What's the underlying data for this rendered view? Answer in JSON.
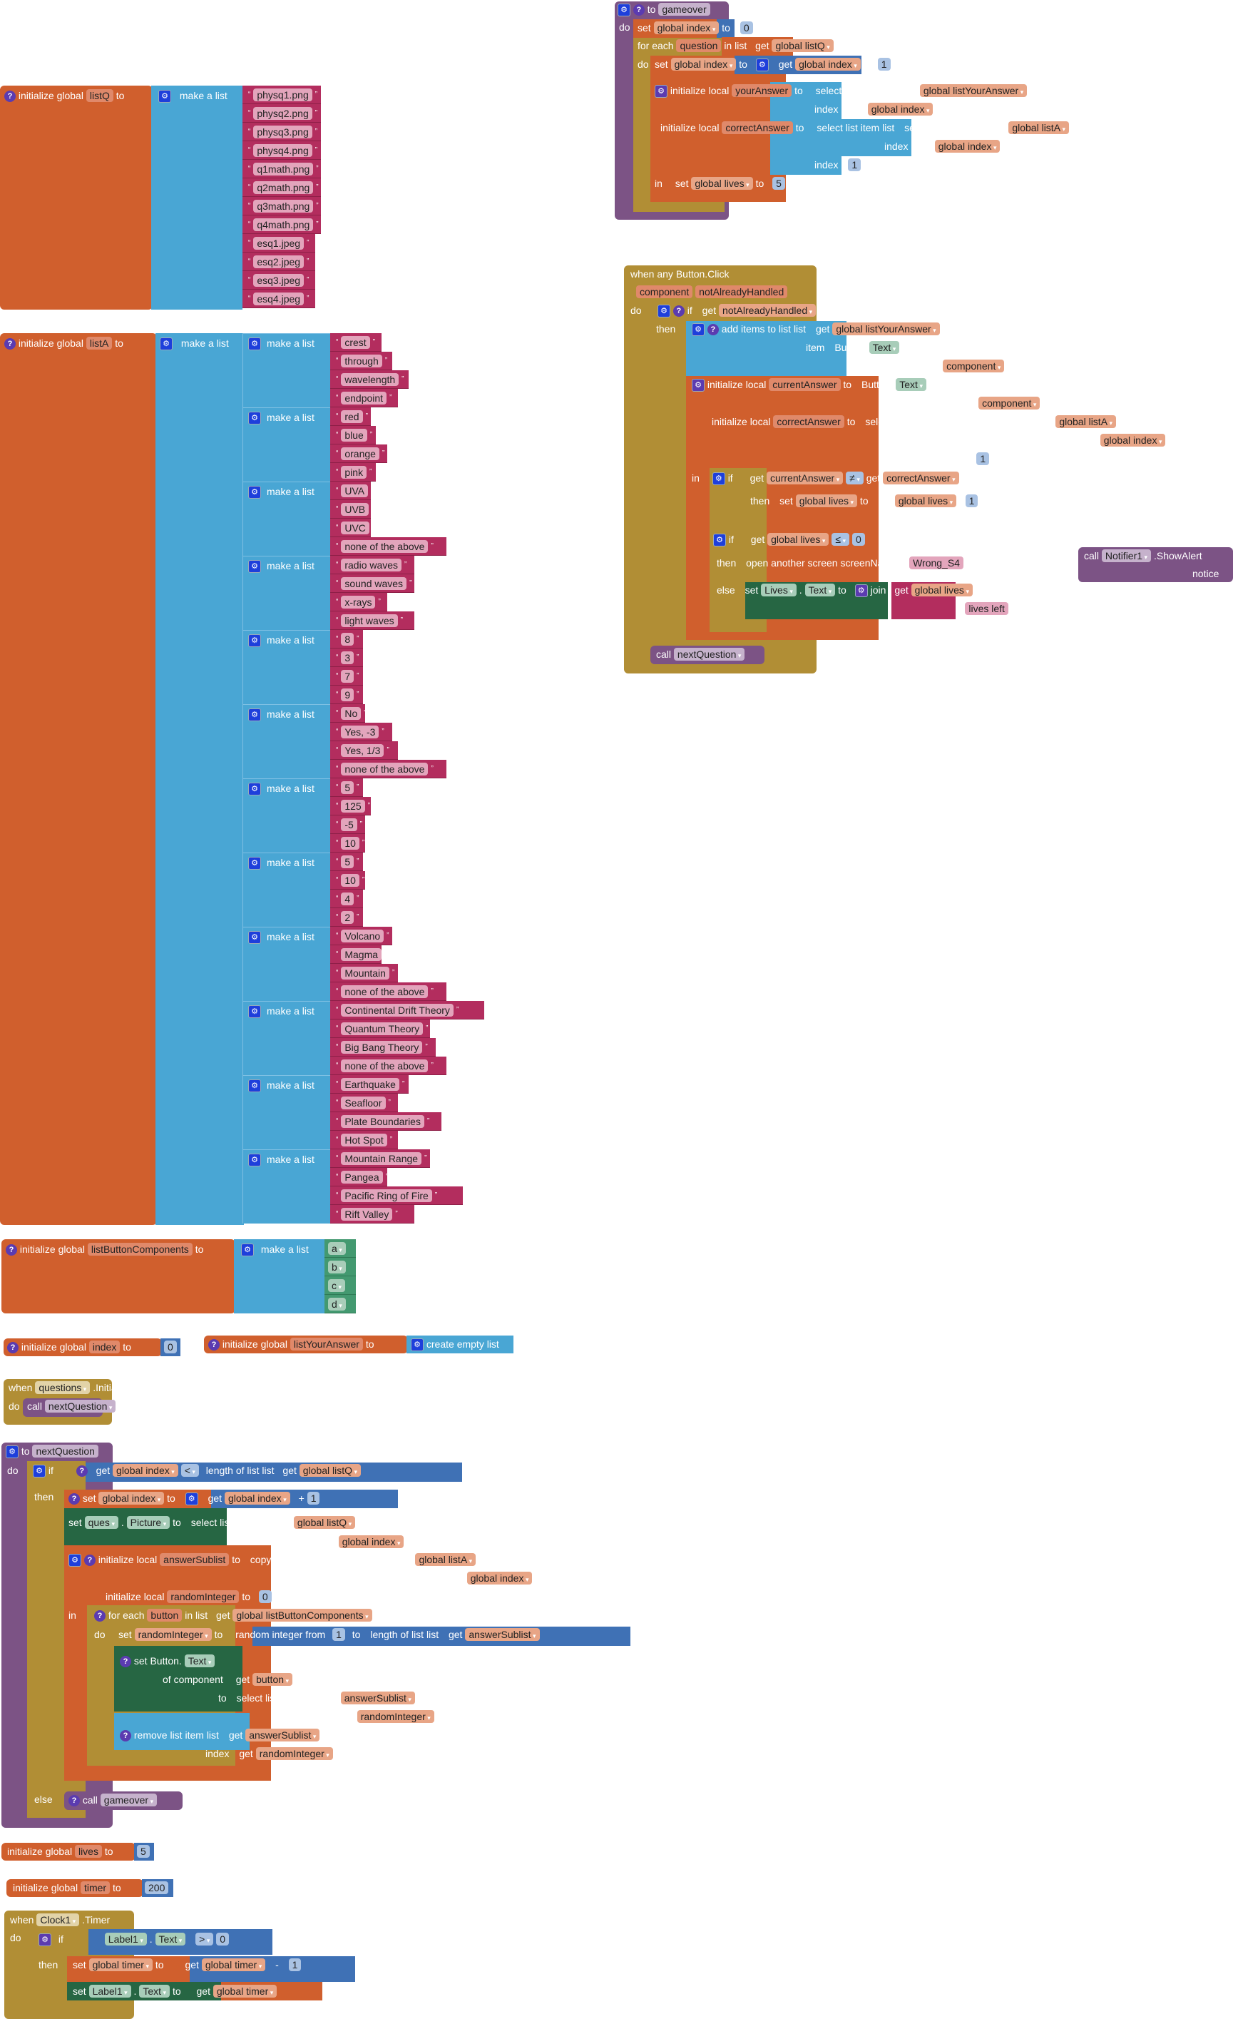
{
  "listQ": {
    "init_label": "initialize global",
    "var_name": "listQ",
    "to_label": "to",
    "make_list_label": "make a list",
    "items": [
      "physq1.png",
      "physq2.png",
      "physq3.png",
      "physq4.png",
      "q1math.png",
      "q2math.png",
      "q3math.png",
      "q4math.png",
      "esq1.jpeg",
      "esq2.jpeg",
      "esq3.jpeg",
      "esq4.jpeg"
    ]
  },
  "listA": {
    "init_label": "initialize global",
    "var_name": "listA",
    "to_label": "to",
    "make_list_label": "make a list",
    "groups": [
      [
        "crest",
        "through",
        "wavelength",
        "endpoint"
      ],
      [
        "red",
        "blue",
        "orange",
        "pink"
      ],
      [
        "UVA",
        "UVB",
        "UVC",
        "none of the above"
      ],
      [
        "radio waves",
        "sound waves",
        "x-rays",
        "light waves"
      ],
      [
        "8",
        "3",
        "7",
        "9"
      ],
      [
        "No",
        "Yes, -3",
        "Yes, 1/3",
        "none of the above"
      ],
      [
        "5",
        "125",
        "-5",
        "10"
      ],
      [
        "5",
        "10",
        "4",
        "2"
      ],
      [
        "Volcano",
        "Magma",
        "Mountain",
        "none of the above"
      ],
      [
        "Continental Drift Theory",
        "Quantum Theory",
        "Big Bang Theory",
        "none of the above"
      ],
      [
        "Earthquake",
        "Seafloor",
        "Plate Boundaries",
        "Hot Spot"
      ],
      [
        "Mountain Range",
        "Pangea",
        "Pacific Ring of Fire",
        "Rift Valley"
      ]
    ]
  },
  "listButtonComponents": {
    "init_label": "initialize global",
    "var_name": "listButtonComponents",
    "to_label": "to",
    "make_list_label": "make a list",
    "items": [
      "a",
      "b",
      "c",
      "d"
    ]
  },
  "index_init": {
    "init_label": "initialize global",
    "var_name": "index",
    "to_label": "to",
    "value": "0"
  },
  "listYourAnswer_init": {
    "init_label": "initialize global",
    "var_name": "listYourAnswer",
    "to_label": "to",
    "value_label": "create empty list"
  },
  "questions_init": {
    "when": "when",
    "component": "questions",
    "event": ".Initialize",
    "do": "do",
    "call": "call",
    "proc": "nextQuestion"
  },
  "gameover": {
    "to": "to",
    "name": "gameover",
    "do": "do",
    "set": "set",
    "global_index": "global index",
    "zero": "0",
    "for_each": "for each",
    "question": "question",
    "in_list": "in list",
    "get": "get",
    "global_listQ": "global listQ",
    "do2": "do",
    "plus": "+",
    "one": "1",
    "init_local": "initialize local",
    "yourAnswer": "yourAnswer",
    "select_list_item": "select list item",
    "list": "list",
    "index": "index",
    "global_listYourAnswer": "global listYourAnswer",
    "correctAnswer": "correctAnswer",
    "global_listA": "global listA",
    "in": "in",
    "global_lives": "global lives",
    "five": "5"
  },
  "button_click": {
    "title": "when any Button.Click",
    "param_component": "component",
    "param_notAlreadyHandled": "notAlreadyHandled",
    "do": "do",
    "if": "if",
    "get": "get",
    "then": "then",
    "add_items": "add items to list",
    "list": "list",
    "item": "item",
    "global_listYourAnswer": "global listYourAnswer",
    "button": "Button.",
    "text": "Text",
    "of_component": "of component",
    "component": "component",
    "init_local": "initialize local",
    "currentAnswer": "currentAnswer",
    "to": "to",
    "correctAnswer": "correctAnswer",
    "select_list_item": "select list item",
    "global_listA": "global listA",
    "index": "index",
    "global_index": "global index",
    "one": "1",
    "in": "in",
    "neq": "≠",
    "set": "set",
    "global_lives": "global lives",
    "minus": "-",
    "lte": "≤",
    "zero": "0",
    "open_screen": "open another screen",
    "screenName": "screenName",
    "screen_value": "Wrong_S4",
    "else": "else",
    "lives_comp": "Lives",
    "join": "join",
    "lives_left": "lives left",
    "call": "call",
    "nextQuestion": "nextQuestion"
  },
  "notifier": {
    "call": "call",
    "component": "Notifier1",
    "method": ".ShowAlert",
    "notice": "notice"
  },
  "nextQuestion": {
    "to": "to",
    "name": "nextQuestion",
    "do": "do",
    "if": "if",
    "get": "get",
    "global_index": "global index",
    "lt": "<",
    "length_of_list": "length of list",
    "list": "list",
    "global_listQ": "global listQ",
    "then": "then",
    "set": "set",
    "plus": "+",
    "one": "1",
    "ques": "ques",
    "picture": "Picture",
    "select_list_item": "select list item",
    "index": "index",
    "init_local": "initialize local",
    "answerSublist": "answerSublist",
    "copy_list": "copy list",
    "global_listA": "global listA",
    "randomInteger": "randomInteger",
    "zero": "0",
    "in": "in",
    "for_each": "for each",
    "button": "button",
    "in_list": "in list",
    "global_listButtonComponents": "global listButtonComponents",
    "random_from": "random integer from",
    "to_label": "to",
    "set_button": "set Button.",
    "text": "Text",
    "of_component": "of component",
    "remove_item": "remove list item",
    "else": "else",
    "call": "call",
    "gameover": "gameover"
  },
  "lives_init": {
    "init_label": "initialize global",
    "var_name": "lives",
    "to_label": "to",
    "value": "5"
  },
  "timer_init": {
    "init_label": "initialize global",
    "var_name": "timer",
    "to_label": "to",
    "value": "200"
  },
  "clock": {
    "when": "when",
    "component": "Clock1",
    "event": ".Timer",
    "do": "do",
    "if": "if",
    "label": "Label1",
    "text": "Text",
    "gt": ">",
    "zero": "0",
    "then": "then",
    "set": "set",
    "global_timer": "global timer",
    "to": "to",
    "get": "get",
    "minus": "-",
    "one": "1"
  }
}
